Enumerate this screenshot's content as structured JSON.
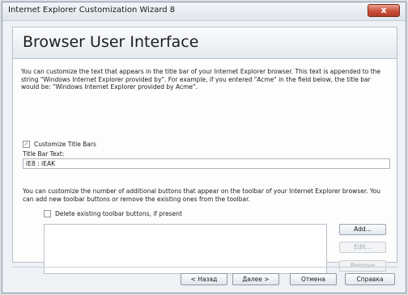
{
  "window": {
    "title": "Internet Explorer Customization Wizard 8",
    "close_glyph": "x"
  },
  "page": {
    "title": "Browser User Interface",
    "description": "You can customize the text that appears in the title bar of your Internet Explorer browser. This text is appended to the string \"Windows Internet Explorer provided by\". For example, if you entered \"Acme\" in the field below, the title bar would be: \"Windows Internet Explorer provided by Acme\"."
  },
  "customize_title": {
    "checked": true,
    "label": "Customize Title Bars",
    "check_glyph": "✓"
  },
  "title_bar_text": {
    "label": "Title Bar Text:",
    "value": "IE8 : IEAK"
  },
  "toolbar_section": {
    "description": "You can customize the number of additional buttons that appear on the toolbar of your Internet Explorer browser. You can add new toolbar buttons or remove the existing ones from the toolbar.",
    "delete_checkbox_label": "Delete existing toolbar buttons, if present",
    "delete_checked": false
  },
  "side_buttons": {
    "add": "Add...",
    "edit": "Edit...",
    "remove": "Remove"
  },
  "nav": {
    "back": "< Назад",
    "next": "Далее >",
    "cancel": "Отмена",
    "help": "Справка"
  }
}
